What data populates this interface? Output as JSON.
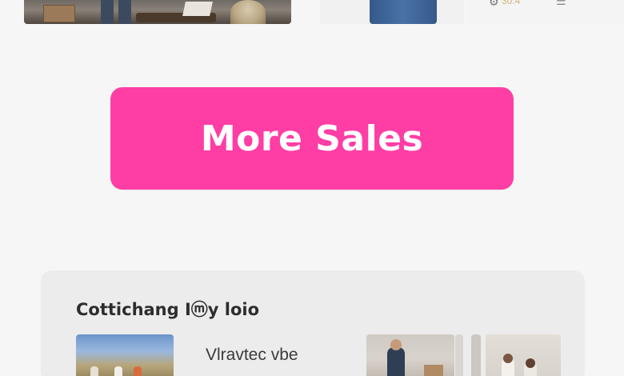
{
  "top_strip": {
    "items": [
      {
        "icon": "photo-scene",
        "label": ""
      },
      {
        "icon": "jeans-photo",
        "label": ""
      },
      {
        "icon": "gear-icon",
        "price_text": "30.4",
        "menu_icon": "menu-icon"
      }
    ]
  },
  "cta": {
    "label": "More Sales",
    "color": "#ff3ea5"
  },
  "card": {
    "title": "Cottichang Iⓜy loio",
    "subtitle": "Vlravtec vbe"
  }
}
